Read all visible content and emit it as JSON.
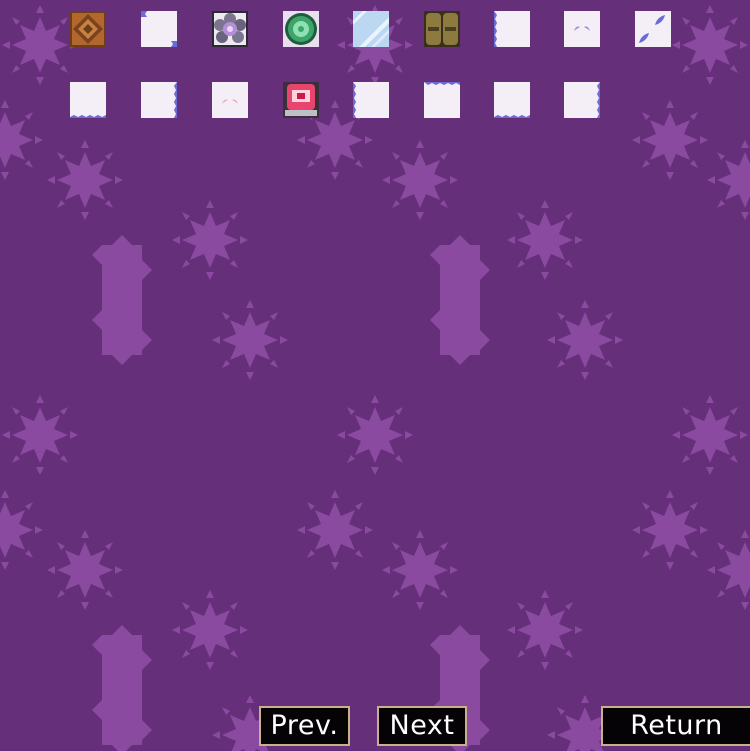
{
  "navigation": {
    "prev_label": "Prev.",
    "next_label": "Next",
    "return_label": "Return"
  },
  "colors": {
    "background": "#652f7a",
    "splotch": "#8a4aa0",
    "button_fill": "#050305",
    "button_border": "#c7b08a",
    "button_text": "#ffffff"
  },
  "tiles": [
    {
      "icon": "wooden-crate-icon"
    },
    {
      "icon": "blank-tile-icon"
    },
    {
      "icon": "gem-flower-tile-icon"
    },
    {
      "icon": "green-orb-tile-icon"
    },
    {
      "icon": "ice-tile-icon"
    },
    {
      "icon": "boots-tile-icon"
    },
    {
      "icon": "blank-tile-icon"
    },
    {
      "icon": "sprout-tile-icon"
    },
    {
      "icon": "leaves-tile-icon"
    },
    {
      "icon": "blank-tile-icon"
    },
    {
      "icon": "blank-tile-icon"
    },
    {
      "icon": "pink-sprout-tile-icon"
    },
    {
      "icon": "red-shrine-tile-icon"
    },
    {
      "icon": "blank-tile-icon"
    },
    {
      "icon": "blank-tile-icon"
    },
    {
      "icon": "blank-tile-icon"
    },
    {
      "icon": "blank-tile-icon"
    }
  ]
}
